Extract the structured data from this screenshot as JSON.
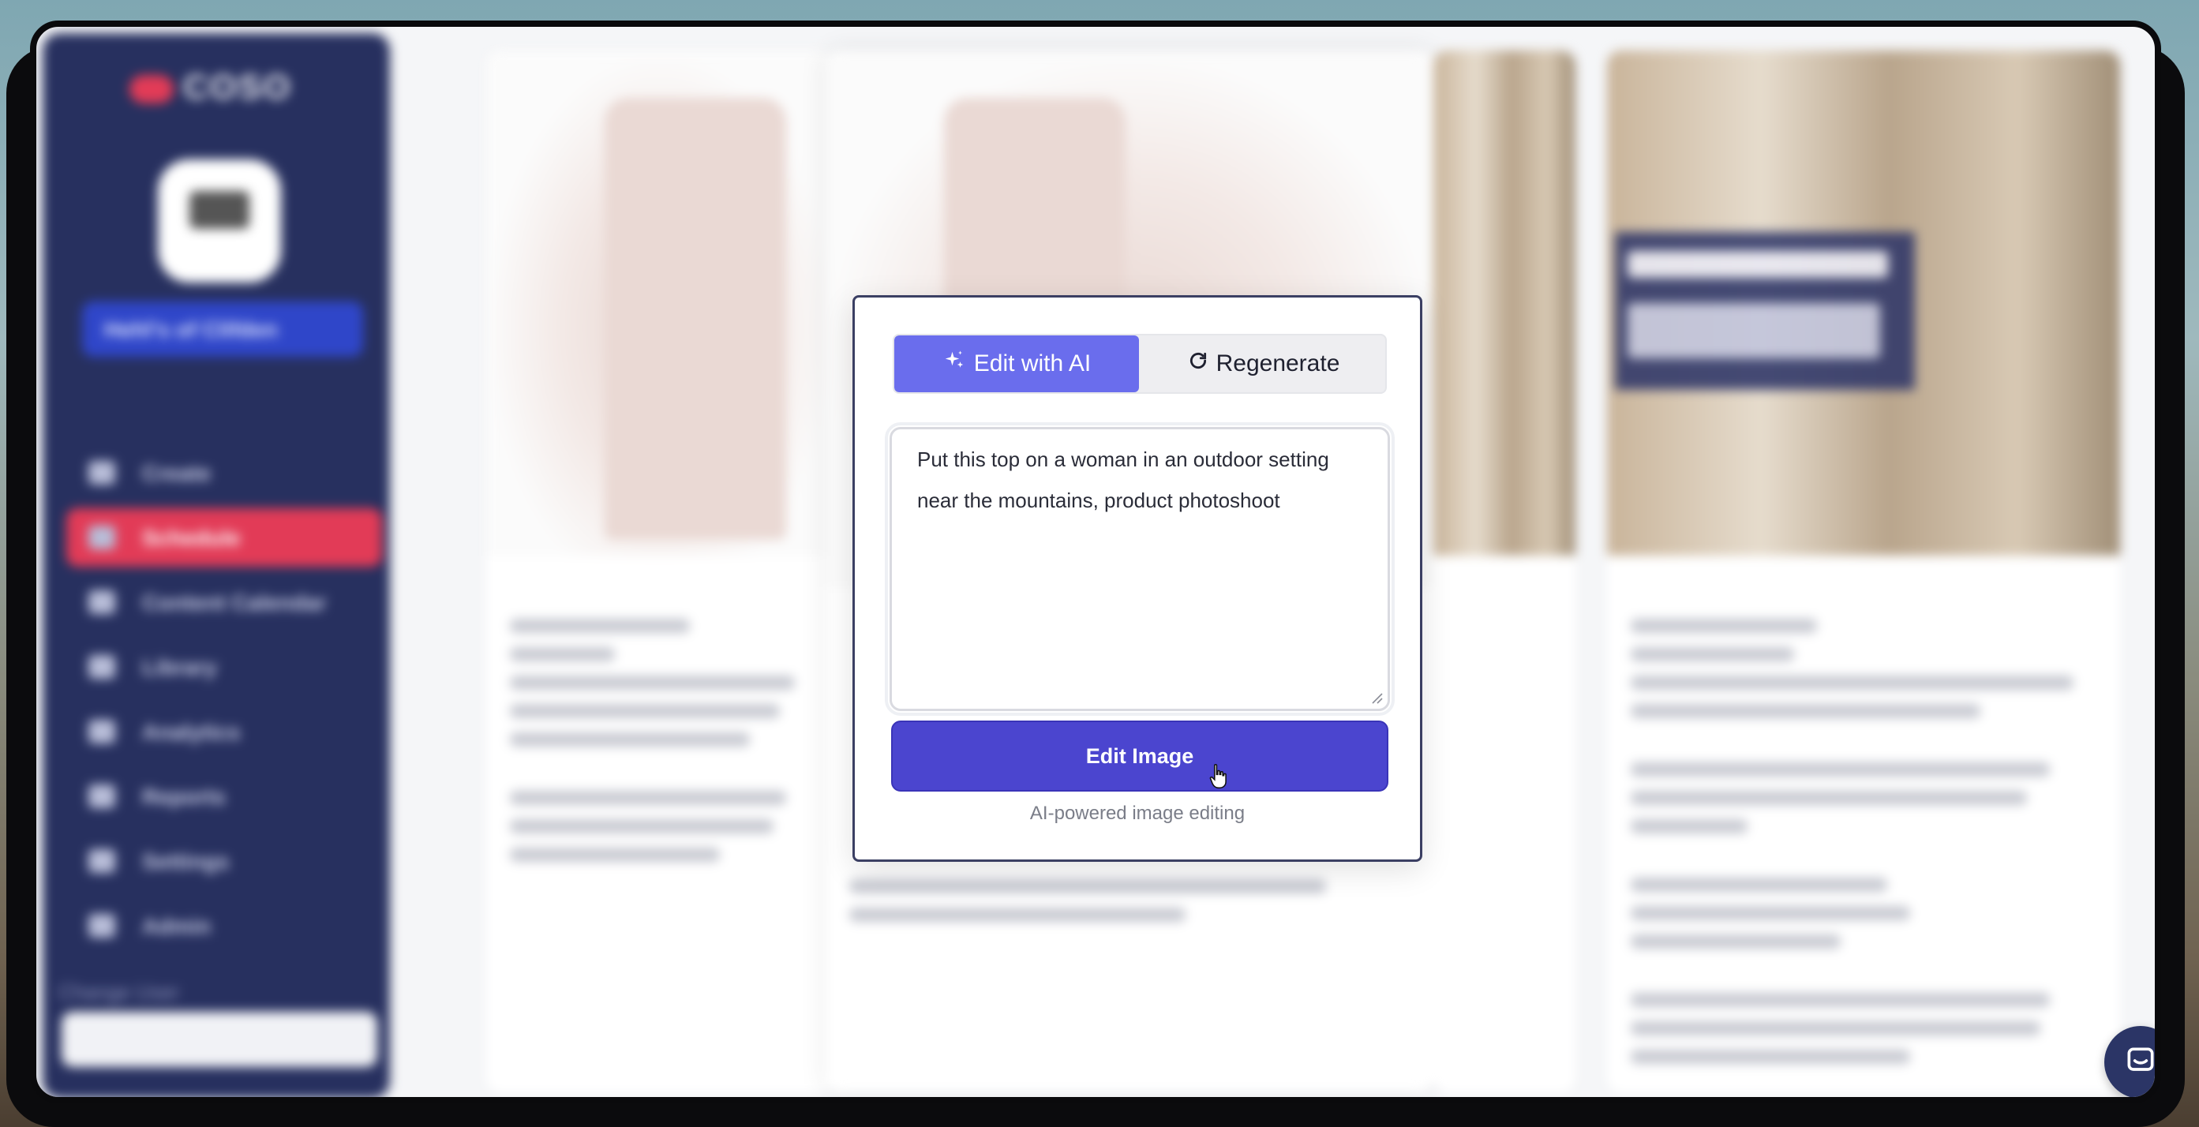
{
  "app": {
    "logo_text": "COSO",
    "account_name": "Hehl's of Clifden",
    "nav_items": [
      "Create",
      "Schedule",
      "Content Calendar",
      "Library",
      "Analytics",
      "Reports",
      "Settings",
      "Admin"
    ],
    "active_nav": "Schedule",
    "change_user_label": "Change User"
  },
  "modal": {
    "tabs": [
      {
        "label": "Edit with AI",
        "icon": "sparkles-icon",
        "active": true
      },
      {
        "label": "Regenerate",
        "icon": "refresh-icon",
        "active": false
      }
    ],
    "prompt_value": "Put this top on a woman in an outdoor setting near the mountains, product photoshoot",
    "edit_button_label": "Edit Image",
    "caption": "AI-powered image editing"
  },
  "colors": {
    "accent": "#6a6ded",
    "primary_button": "#4b45cf",
    "sidebar": "#27305f",
    "active_nav": "#e23b57"
  }
}
